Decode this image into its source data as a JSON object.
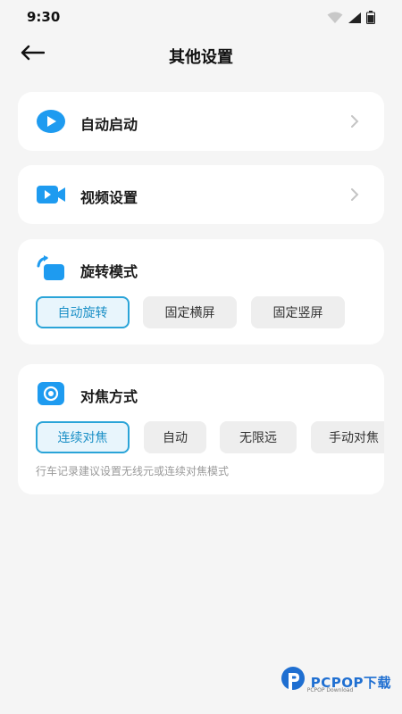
{
  "status": {
    "time": "9:30"
  },
  "header": {
    "title": "其他设置"
  },
  "rows": [
    {
      "label": "自动启动",
      "icon": "play-circle-icon"
    },
    {
      "label": "视频设置",
      "icon": "video-camera-icon"
    }
  ],
  "rotation": {
    "label": "旋转模式",
    "icon": "rotate-screen-icon",
    "options": [
      "自动旋转",
      "固定横屏",
      "固定竖屏"
    ],
    "selected": "自动旋转"
  },
  "focus": {
    "label": "对焦方式",
    "icon": "focus-target-icon",
    "options": [
      "连续对焦",
      "自动",
      "无限远",
      "手动对焦"
    ],
    "selected": "连续对焦",
    "hint": "行车记录建议设置无线元或连续对焦模式"
  },
  "watermark": {
    "text": "PCPOP下载",
    "sub": "PCPOP Download"
  },
  "colors": {
    "accent": "#2aa4d8",
    "icon_blue": "#1e9bf0",
    "card_bg": "#ffffff",
    "page_bg": "#f5f5f5"
  }
}
